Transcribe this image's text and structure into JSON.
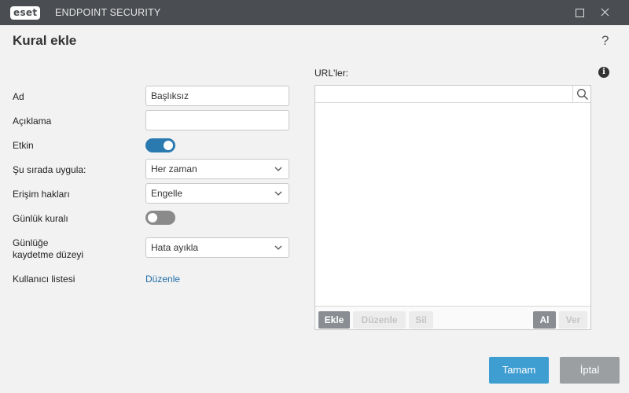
{
  "titlebar": {
    "logo_text": "eset",
    "app_name": "ENDPOINT SECURITY"
  },
  "header": {
    "title": "Kural ekle",
    "help": "?"
  },
  "form": {
    "name": {
      "label": "Ad",
      "value": "Başlıksız"
    },
    "description": {
      "label": "Açıklama",
      "value": ""
    },
    "enabled": {
      "label": "Etkin",
      "state": "on"
    },
    "apply_during": {
      "label": "Şu sırada uygula:",
      "value": "Her zaman"
    },
    "access_rights": {
      "label": "Erişim hakları",
      "value": "Engelle"
    },
    "log_rule": {
      "label": "Günlük kuralı",
      "state": "off"
    },
    "log_severity": {
      "label_line1": "Günlüğe",
      "label_line2": "kaydetme düzeyi",
      "value": "Hata ayıkla"
    },
    "user_list": {
      "label": "Kullanıcı listesi",
      "link": "Düzenle"
    }
  },
  "urls": {
    "label": "URL'ler:",
    "info": "i",
    "search_value": "",
    "items": [],
    "toolbar": {
      "add": "Ekle",
      "edit": "Düzenle",
      "delete": "Sil",
      "import": "Al",
      "export": "Ver"
    }
  },
  "footer": {
    "ok": "Tamam",
    "cancel": "İptal"
  },
  "colors": {
    "titlebar": "#4a4d51",
    "accent": "#2a7ab0",
    "primary_button": "#3f9ed1",
    "secondary_button": "#9c9fa2",
    "link": "#1f6da8"
  }
}
